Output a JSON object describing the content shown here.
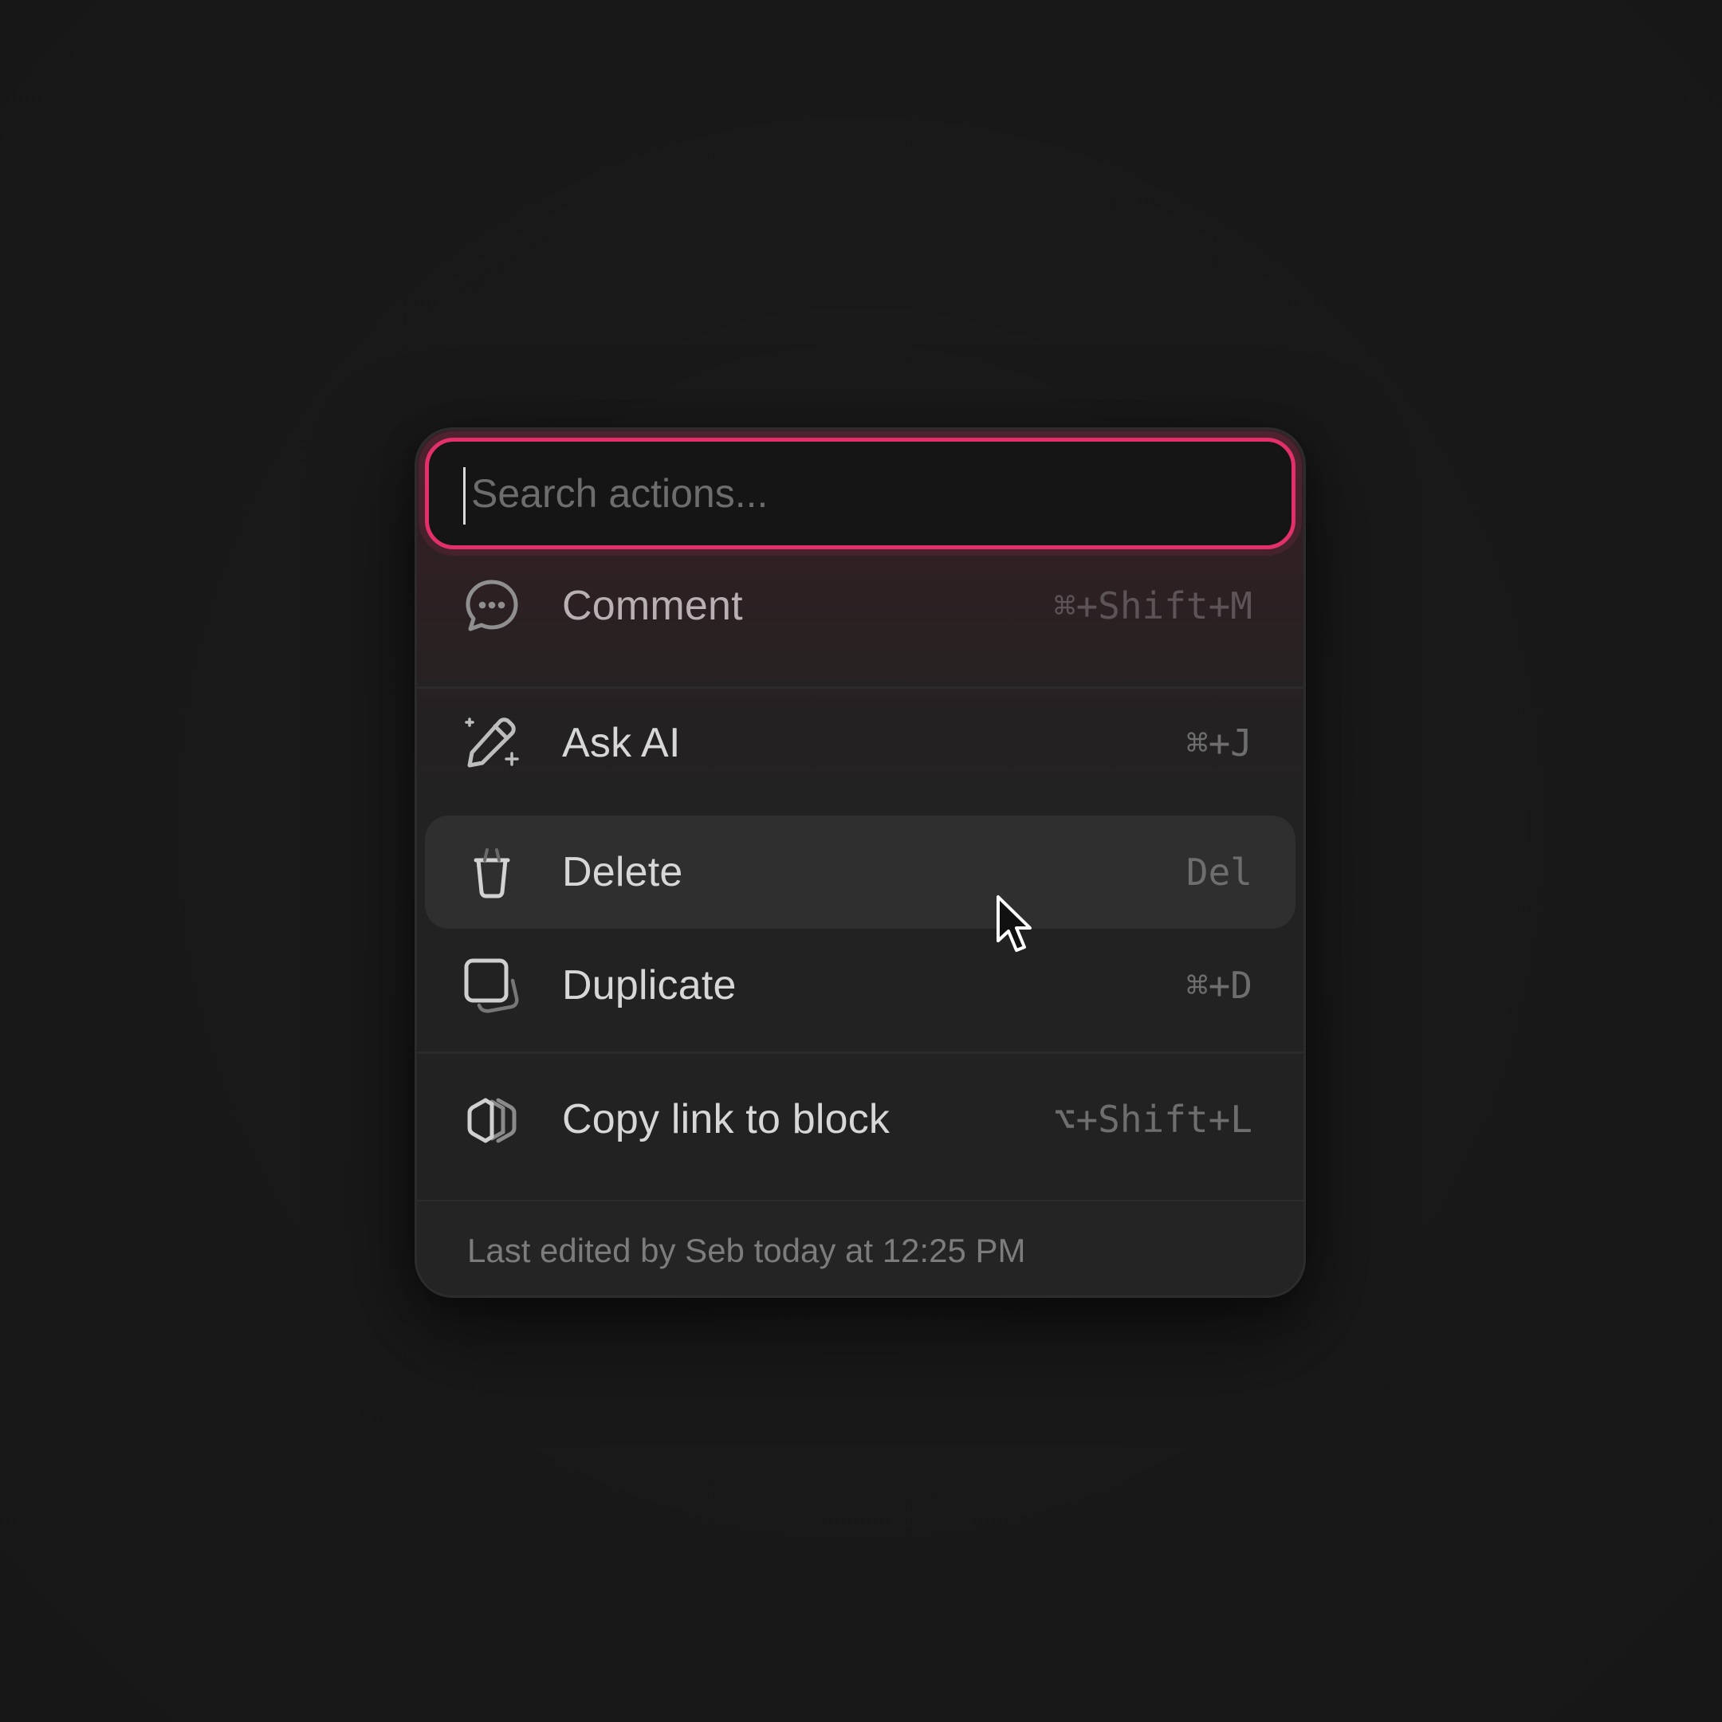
{
  "search": {
    "placeholder": "Search actions...",
    "value": ""
  },
  "menu": {
    "items": [
      {
        "label": "Comment",
        "shortcut": "⌘+Shift+M",
        "icon": "comment-icon"
      },
      {
        "label": "Ask AI",
        "shortcut": "⌘+J",
        "icon": "ai-pencil-sparkle-icon"
      },
      {
        "label": "Delete",
        "shortcut": "Del",
        "icon": "trash-icon",
        "hovered": true
      },
      {
        "label": "Duplicate",
        "shortcut": "⌘+D",
        "icon": "duplicate-icon"
      },
      {
        "label": "Copy link to block",
        "shortcut": "⌥+Shift+L",
        "icon": "link-icon"
      }
    ]
  },
  "footer": {
    "text": "Last edited by Seb today at 12:25 PM"
  },
  "colors": {
    "accent": "#e3306a",
    "background": "#181818",
    "panel": "#222222",
    "hover": "#2f2f2f"
  }
}
